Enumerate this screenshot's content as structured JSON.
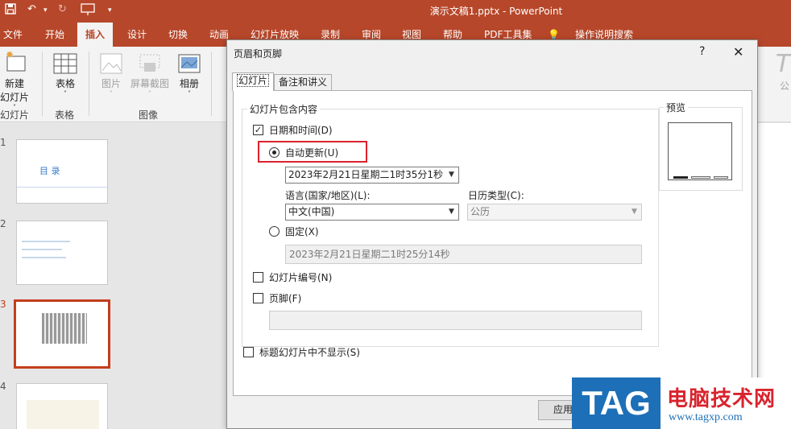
{
  "app": {
    "window_title": "演示文稿1.pptx  -  PowerPoint",
    "quick_access": {
      "save": "save-icon",
      "undo": "undo-icon",
      "redo": "redo-icon",
      "customize": "▾"
    },
    "tabs": [
      "文件",
      "开始",
      "插入",
      "设计",
      "切换",
      "动画",
      "幻灯片放映",
      "录制",
      "审阅",
      "视图",
      "帮助",
      "PDF工具集",
      "操作说明搜索"
    ],
    "active_tab": "插入"
  },
  "ribbon": {
    "new_slide": "新建\n幻灯片",
    "new_slide_line1": "新建",
    "new_slide_line2": "幻灯片",
    "table": "表格",
    "picture": "图片",
    "screenshot": "屏幕截图",
    "album": "相册",
    "groups": {
      "slides": "幻灯片",
      "tables": "表格",
      "images": "图像"
    },
    "right_partial": "公"
  },
  "slides": {
    "numbers": [
      "1",
      "2",
      "3",
      "4"
    ],
    "slide1_title": "目    录"
  },
  "dialog": {
    "title": "页眉和页脚",
    "help": "?",
    "close": "✕",
    "tabs": [
      "幻灯片",
      "备注和讲义"
    ],
    "group_title": "幻灯片包含内容",
    "date_time": {
      "label": "日期和时间(D)",
      "checked": true
    },
    "auto_update": {
      "label": "自动更新(U)",
      "selected": true
    },
    "auto_value": "2023年2月21日星期二1时35分1秒",
    "language_label": "语言(国家/地区)(L):",
    "language_value": "中文(中国)",
    "calendar_label": "日历类型(C):",
    "calendar_value": "公历",
    "fixed": {
      "label": "固定(X)",
      "selected": false
    },
    "fixed_value": "2023年2月21日星期二1时25分14秒",
    "slide_number": {
      "label": "幻灯片编号(N)",
      "checked": false
    },
    "footer": {
      "label": "页脚(F)",
      "checked": false
    },
    "footer_value": "",
    "hide_title": {
      "label": "标题幻灯片中不显示(S)",
      "checked": false
    },
    "preview_title": "预览",
    "apply_button": "应用"
  },
  "watermark": {
    "logo": "TAG",
    "name": "电脑技术网",
    "url": "www.tagxp.com"
  }
}
